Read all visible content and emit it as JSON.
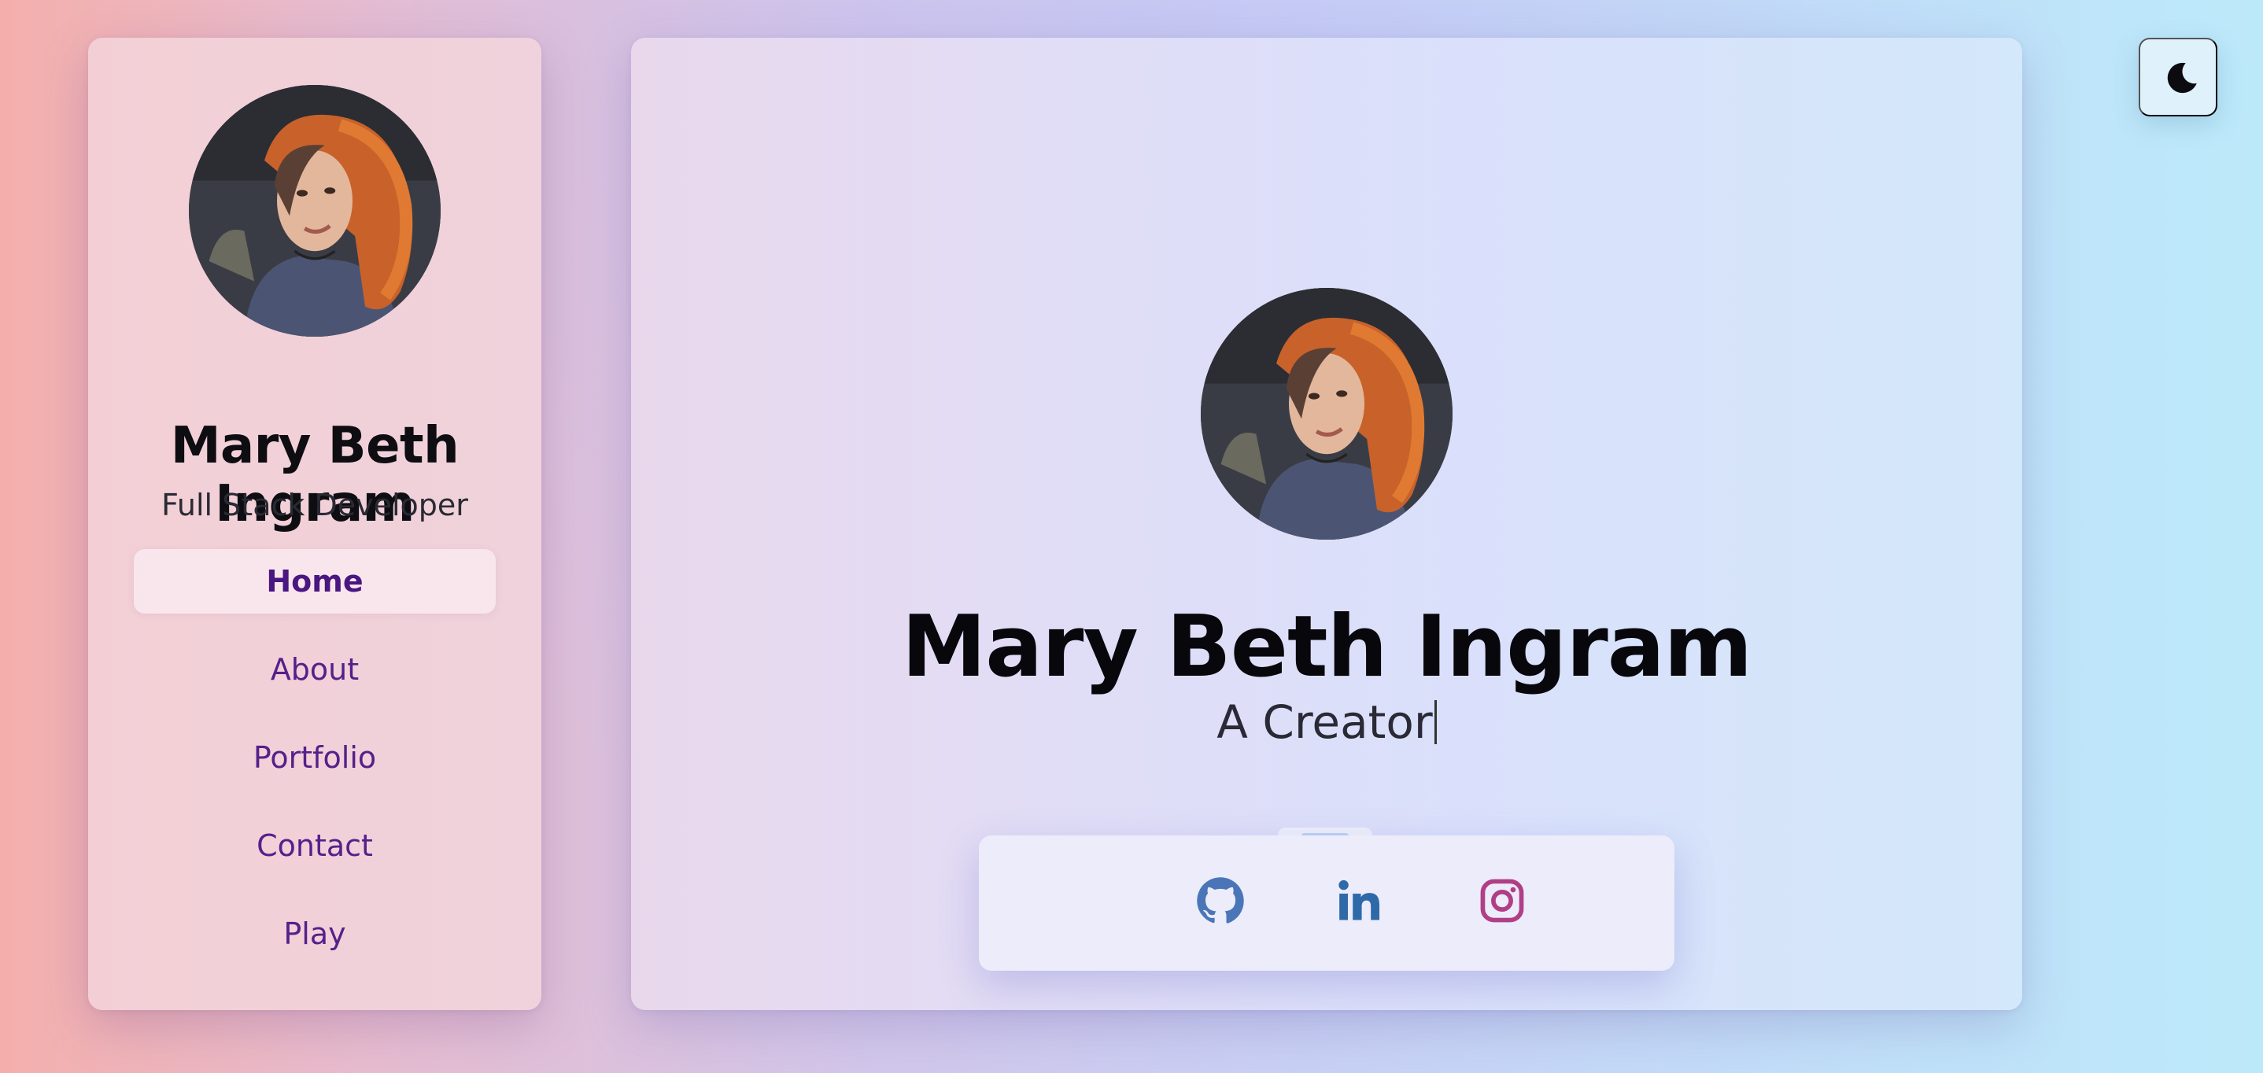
{
  "sidebar": {
    "name": "Mary Beth Ingram",
    "role": "Full Stack Developer",
    "nav": [
      {
        "label": "Home",
        "active": true
      },
      {
        "label": "About",
        "active": false
      },
      {
        "label": "Portfolio",
        "active": false
      },
      {
        "label": "Contact",
        "active": false
      },
      {
        "label": "Play",
        "active": false
      }
    ]
  },
  "hero": {
    "name": "Mary Beth Ingram",
    "tagline": "A Creator"
  },
  "social": [
    {
      "icon": "github-icon",
      "color": "#4a76b8"
    },
    {
      "icon": "linkedin-icon",
      "color": "#2f6aa8"
    },
    {
      "icon": "instagram-icon",
      "color": "#b03f86"
    }
  ],
  "theme_toggle": {
    "icon": "moon-icon"
  },
  "colors": {
    "nav_text": "#55208a",
    "nav_active_bg": "#f8e6ec"
  }
}
